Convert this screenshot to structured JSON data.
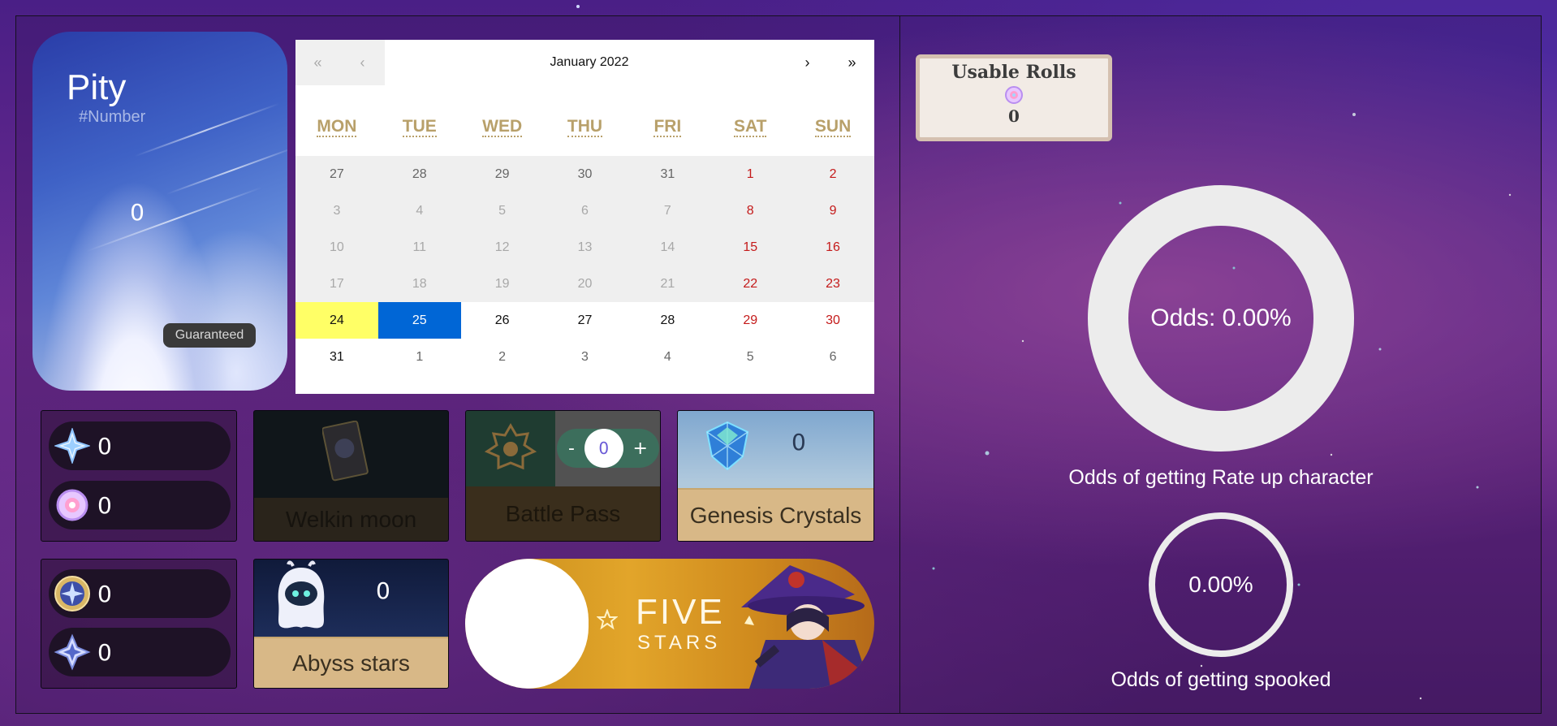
{
  "pity": {
    "title": "Pity",
    "subtitle": "#Number",
    "value": "0",
    "guaranteed_label": "Guaranteed"
  },
  "calendar": {
    "title": "January 2022",
    "nav": {
      "prev_year": "«",
      "prev_month": "‹",
      "next_month": "›",
      "next_year": "»"
    },
    "weekdays": [
      "MON",
      "TUE",
      "WED",
      "THU",
      "FRI",
      "SAT",
      "SUN"
    ],
    "days": [
      {
        "d": "27",
        "c": "c-gray",
        "p": true
      },
      {
        "d": "28",
        "c": "c-gray",
        "p": true
      },
      {
        "d": "29",
        "c": "c-gray",
        "p": true
      },
      {
        "d": "30",
        "c": "c-gray",
        "p": true
      },
      {
        "d": "31",
        "c": "c-gray",
        "p": true
      },
      {
        "d": "1",
        "c": "c-red",
        "p": true
      },
      {
        "d": "2",
        "c": "c-red",
        "p": true
      },
      {
        "d": "3",
        "c": "c-light",
        "p": true
      },
      {
        "d": "4",
        "c": "c-light",
        "p": true
      },
      {
        "d": "5",
        "c": "c-light",
        "p": true
      },
      {
        "d": "6",
        "c": "c-light",
        "p": true
      },
      {
        "d": "7",
        "c": "c-light",
        "p": true
      },
      {
        "d": "8",
        "c": "c-red",
        "p": true
      },
      {
        "d": "9",
        "c": "c-red",
        "p": true
      },
      {
        "d": "10",
        "c": "c-light",
        "p": true
      },
      {
        "d": "11",
        "c": "c-light",
        "p": true
      },
      {
        "d": "12",
        "c": "c-light",
        "p": true
      },
      {
        "d": "13",
        "c": "c-light",
        "p": true
      },
      {
        "d": "14",
        "c": "c-light",
        "p": true
      },
      {
        "d": "15",
        "c": "c-red",
        "p": true
      },
      {
        "d": "16",
        "c": "c-red",
        "p": true
      },
      {
        "d": "17",
        "c": "c-light",
        "p": true
      },
      {
        "d": "18",
        "c": "c-light",
        "p": true
      },
      {
        "d": "19",
        "c": "c-light",
        "p": true
      },
      {
        "d": "20",
        "c": "c-light",
        "p": true
      },
      {
        "d": "21",
        "c": "c-light",
        "p": true
      },
      {
        "d": "22",
        "c": "c-red",
        "p": true
      },
      {
        "d": "23",
        "c": "c-red",
        "p": true
      },
      {
        "d": "24",
        "c": "today"
      },
      {
        "d": "25",
        "c": "selected"
      },
      {
        "d": "26",
        "c": "c-black"
      },
      {
        "d": "27",
        "c": "c-black"
      },
      {
        "d": "28",
        "c": "c-black"
      },
      {
        "d": "29",
        "c": "c-red"
      },
      {
        "d": "30",
        "c": "c-red"
      },
      {
        "d": "31",
        "c": "c-black"
      },
      {
        "d": "1",
        "c": "c-gray"
      },
      {
        "d": "2",
        "c": "c-gray"
      },
      {
        "d": "3",
        "c": "c-gray"
      },
      {
        "d": "4",
        "c": "c-gray"
      },
      {
        "d": "5",
        "c": "c-gray"
      },
      {
        "d": "6",
        "c": "c-gray"
      }
    ]
  },
  "currencies": {
    "primogems": {
      "icon": "primogem-icon",
      "value": "0"
    },
    "intertwined_fate": {
      "icon": "intertwined-fate-icon",
      "value": "0"
    },
    "masterless_starglitter": {
      "icon": "starglitter-icon",
      "value": "0"
    },
    "masterless_stardust": {
      "icon": "stardust-icon",
      "value": "0"
    }
  },
  "tiles": {
    "welkin": {
      "label": "Welkin moon"
    },
    "battle_pass": {
      "label": "Battle Pass",
      "stepper_minus": "-",
      "stepper_value": "0",
      "stepper_plus": "+"
    },
    "genesis": {
      "label": "Genesis Crystals",
      "value": "0"
    },
    "abyss": {
      "label": "Abyss stars",
      "value": "0"
    },
    "five_stars": {
      "line1": "FIVE",
      "line2": "STARS"
    }
  },
  "rolls": {
    "title": "Usable Rolls",
    "icon": "intertwined-fate-icon",
    "value": "0"
  },
  "odds_rateup": {
    "label": "Odds: 0.00%",
    "caption": "Odds of getting Rate up character",
    "percent": 0
  },
  "odds_spooked": {
    "label": "0.00%",
    "caption": "Odds of getting spooked",
    "percent": 0
  },
  "colors": {
    "accent_gold": "#b8a06a",
    "tile_gold": "#d8b887",
    "selected_blue": "#0066d6",
    "today_yellow": "#ffff66",
    "weekend_red": "#c41a1a"
  }
}
